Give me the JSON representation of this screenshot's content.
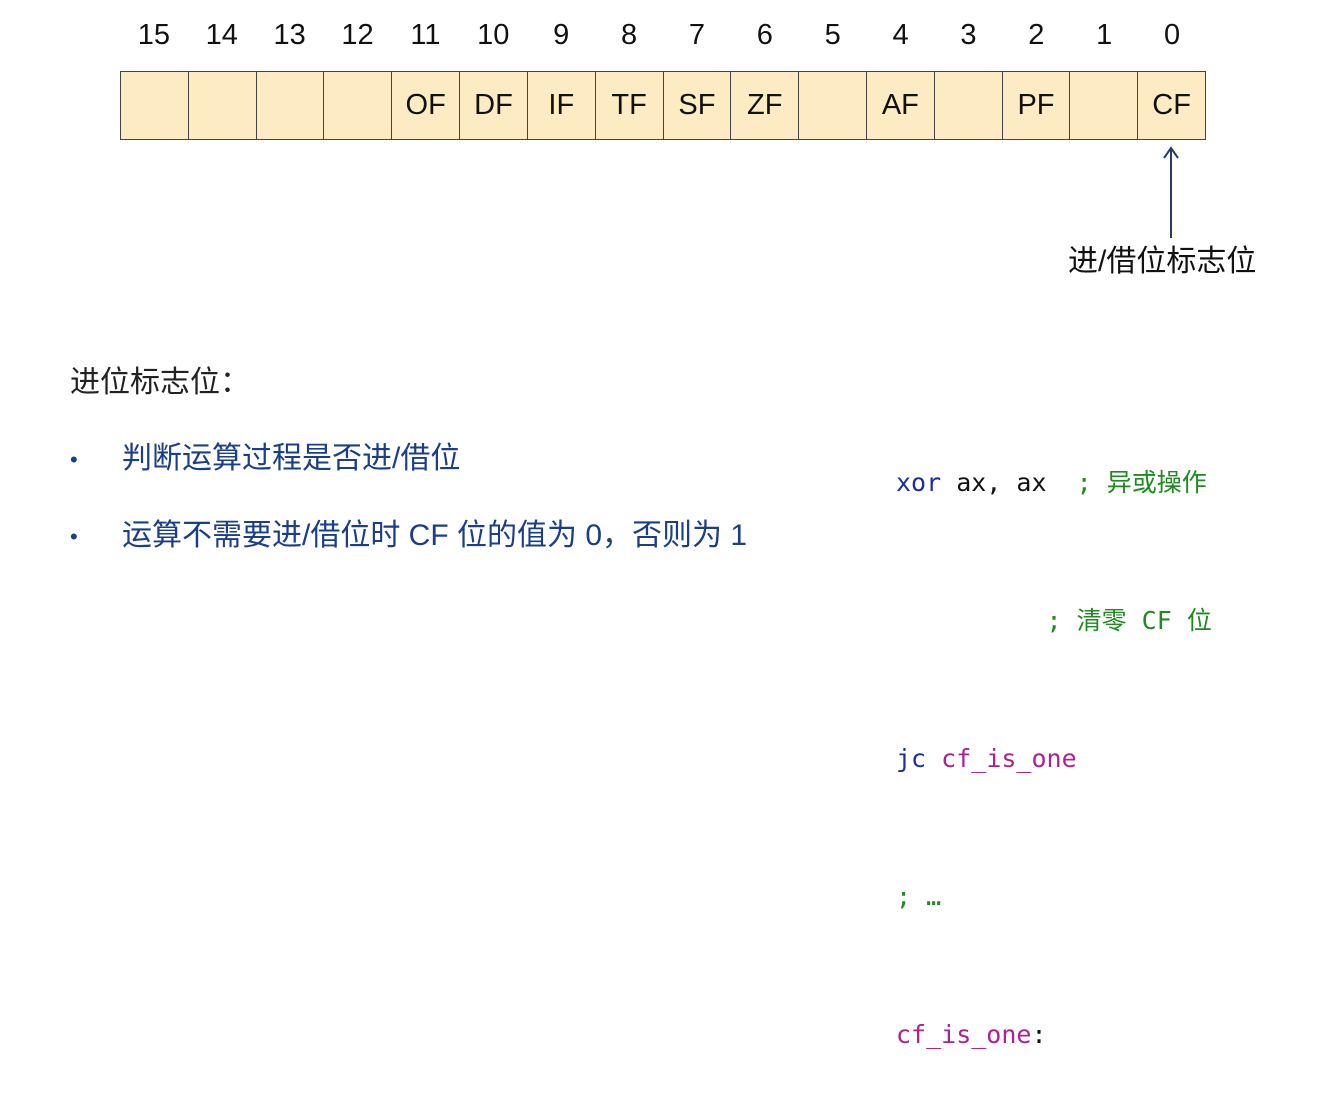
{
  "register": {
    "bit_numbers": [
      "15",
      "14",
      "13",
      "12",
      "11",
      "10",
      "9",
      "8",
      "7",
      "6",
      "5",
      "4",
      "3",
      "2",
      "1",
      "0"
    ],
    "cells": [
      "",
      "",
      "",
      "",
      "OF",
      "DF",
      "IF",
      "TF",
      "SF",
      "ZF",
      "",
      "AF",
      "",
      "PF",
      "",
      "CF"
    ],
    "cell_color": "#fdebc4"
  },
  "cf_caption": "进/借位标志位",
  "section_heading": "进位标志位：",
  "bullets": [
    "判断运算过程是否进/借位",
    "运算不需要进/借位时 CF 位的值为 0，否则为 1"
  ],
  "code": {
    "line1": {
      "instr": "xor",
      "operands": " ax, ax  ",
      "comment": "; 异或操作"
    },
    "line2": {
      "indent": "          ",
      "comment": "; 清零 CF 位"
    },
    "line3": {
      "instr": "jc",
      "label": " cf_is_one"
    },
    "line4": {
      "comment": "; …"
    },
    "line5": {
      "label": "cf_is_one",
      "colon": ":"
    }
  },
  "colors": {
    "keyword": "#1c2fa0",
    "comment": "#1f8a1f",
    "label": "#b0208f",
    "bullet_text": "#1a3e8a"
  }
}
